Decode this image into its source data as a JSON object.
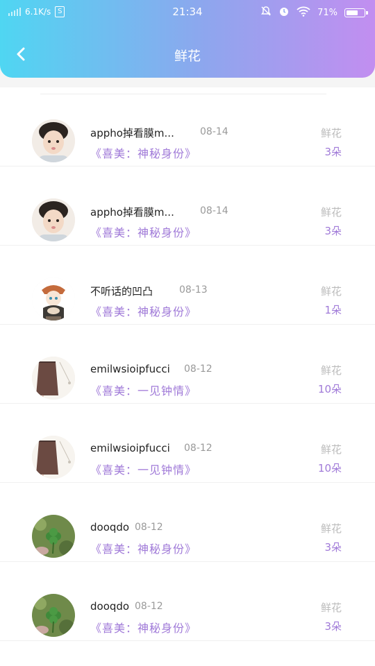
{
  "status_bar": {
    "speed": "6.1K/s",
    "time": "21:34",
    "battery": "71%",
    "battery_level": 0.71
  },
  "header": {
    "title": "鲜花"
  },
  "rows": [
    {
      "name": "appho掉看膜m...",
      "date": "08-14",
      "gift": "《喜美：神秘身份》",
      "label": "鲜花",
      "count": "3朵",
      "avatar": "boy"
    },
    {
      "name": "appho掉看膜m...",
      "date": "08-14",
      "gift": "《喜美：神秘身份》",
      "label": "鲜花",
      "count": "3朵",
      "avatar": "boy"
    },
    {
      "name": "不听话的凹凸",
      "date": "08-13",
      "gift": "《喜美：神秘身份》",
      "label": "鲜花",
      "count": "1朵",
      "avatar": "anime"
    },
    {
      "name": "emilwsioipfucci",
      "date": "08-12",
      "gift": "《喜美：一见钟情》",
      "label": "鲜花",
      "count": "10朵",
      "avatar": "skirt"
    },
    {
      "name": "emilwsioipfucci",
      "date": "08-12",
      "gift": "《喜美：一见钟情》",
      "label": "鲜花",
      "count": "10朵",
      "avatar": "skirt"
    },
    {
      "name": "dooqdo",
      "date": "08-12",
      "gift": "《喜美：神秘身份》",
      "label": "鲜花",
      "count": "3朵",
      "avatar": "clover"
    },
    {
      "name": "dooqdo",
      "date": "08-12",
      "gift": "《喜美：神秘身份》",
      "label": "鲜花",
      "count": "3朵",
      "avatar": "clover"
    }
  ]
}
